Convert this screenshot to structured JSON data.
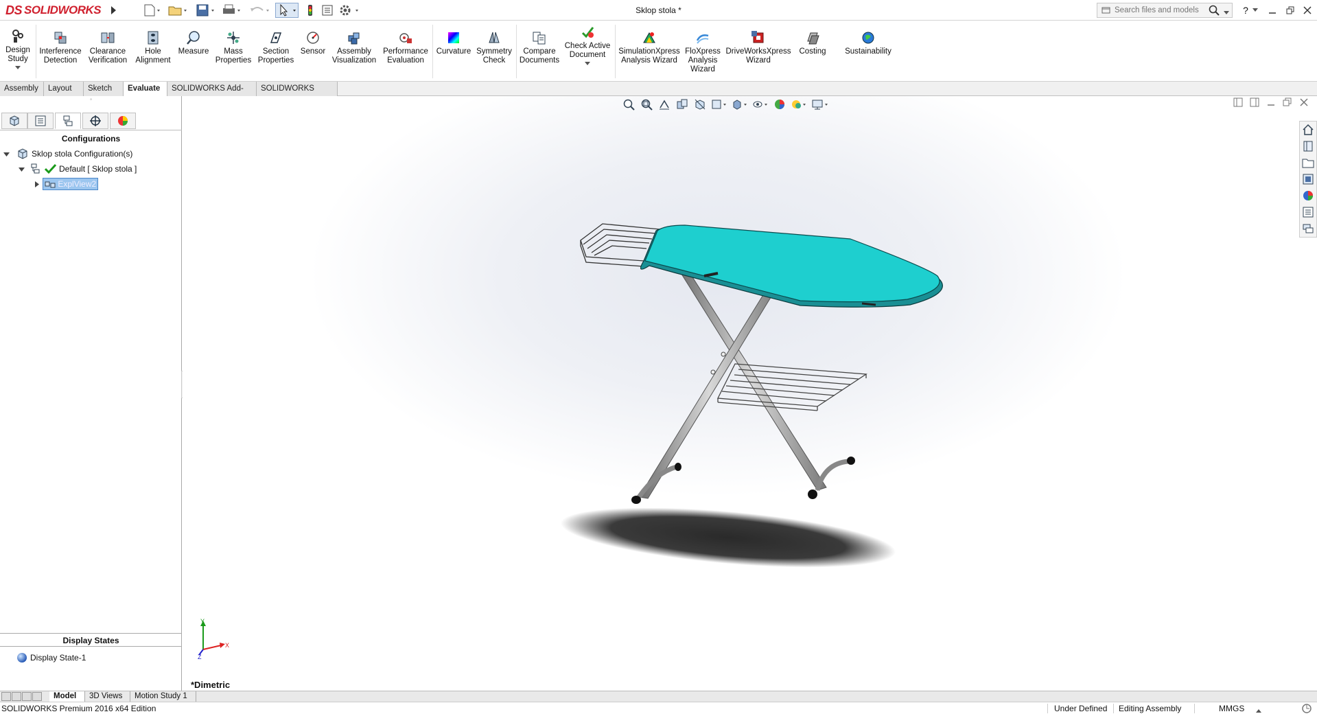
{
  "app": {
    "brand_prefix": "DS",
    "brand": "SOLIDWORKS",
    "document_title": "Sklop stola *",
    "search_placeholder": "Search files and models",
    "help_label": "?"
  },
  "ribbon": {
    "buttons": [
      {
        "id": "design-study",
        "line1": "Design",
        "line2": "Study",
        "icon": "design-study-icon"
      },
      {
        "id": "interference-detection",
        "line1": "Interference",
        "line2": "Detection",
        "icon": "interference-icon"
      },
      {
        "id": "clearance-verification",
        "line1": "Clearance",
        "line2": "Verification",
        "icon": "clearance-icon"
      },
      {
        "id": "hole-alignment",
        "line1": "Hole",
        "line2": "Alignment",
        "icon": "hole-icon"
      },
      {
        "id": "measure",
        "line1": "Measure",
        "line2": "",
        "icon": "measure-icon"
      },
      {
        "id": "mass-properties",
        "line1": "Mass",
        "line2": "Properties",
        "icon": "mass-icon"
      },
      {
        "id": "section-properties",
        "line1": "Section",
        "line2": "Properties",
        "icon": "section-icon"
      },
      {
        "id": "sensor",
        "line1": "Sensor",
        "line2": "",
        "icon": "sensor-icon"
      },
      {
        "id": "assembly-visualization",
        "line1": "Assembly",
        "line2": "Visualization",
        "icon": "assembly-viz-icon"
      },
      {
        "id": "performance-evaluation",
        "line1": "Performance",
        "line2": "Evaluation",
        "icon": "performance-icon"
      },
      {
        "id": "curvature",
        "line1": "Curvature",
        "line2": "",
        "icon": "curvature-icon"
      },
      {
        "id": "symmetry-check",
        "line1": "Symmetry",
        "line2": "Check",
        "icon": "symmetry-icon"
      },
      {
        "id": "compare-documents",
        "line1": "Compare",
        "line2": "Documents",
        "icon": "compare-icon"
      },
      {
        "id": "check-active-document",
        "line1": "Check Active",
        "line2": "Document",
        "icon": "check-doc-icon"
      },
      {
        "id": "simulationxpress",
        "line1": "SimulationXpress",
        "line2": "Analysis Wizard",
        "icon": "simxpress-icon"
      },
      {
        "id": "floxpress",
        "line1": "FloXpress",
        "line2": "Analysis",
        "line3": "Wizard",
        "icon": "floxpress-icon"
      },
      {
        "id": "driveworksxpress",
        "line1": "DriveWorksXpress",
        "line2": "Wizard",
        "icon": "driveworks-icon"
      },
      {
        "id": "costing",
        "line1": "Costing",
        "line2": "",
        "icon": "costing-icon"
      },
      {
        "id": "sustainability",
        "line1": "Sustainability",
        "line2": "",
        "icon": "sustainability-icon"
      }
    ]
  },
  "tabs": [
    "Assembly",
    "Layout",
    "Sketch",
    "Evaluate",
    "SOLIDWORKS Add-Ins",
    "SOLIDWORKS MBD"
  ],
  "active_tab": "Evaluate",
  "left_pane": {
    "heading": "Configurations",
    "root": "Sklop stola Configuration(s)",
    "config": "Default [ Sklop stola ]",
    "exploded_view": "ExplView2",
    "display_states_heading": "Display States",
    "display_state": "Display State-1"
  },
  "viewport": {
    "view_name": "*Dimetric",
    "axis_y": "Y",
    "axis_x": "X",
    "axis_z": "Z",
    "board_color": "#1ecfcf"
  },
  "bottom_tabs": [
    "Model",
    "3D Views",
    "Motion Study 1"
  ],
  "status": {
    "edition": "SOLIDWORKS Premium 2016 x64 Edition",
    "state": "Under Defined",
    "mode": "Editing Assembly",
    "units": "MMGS"
  }
}
